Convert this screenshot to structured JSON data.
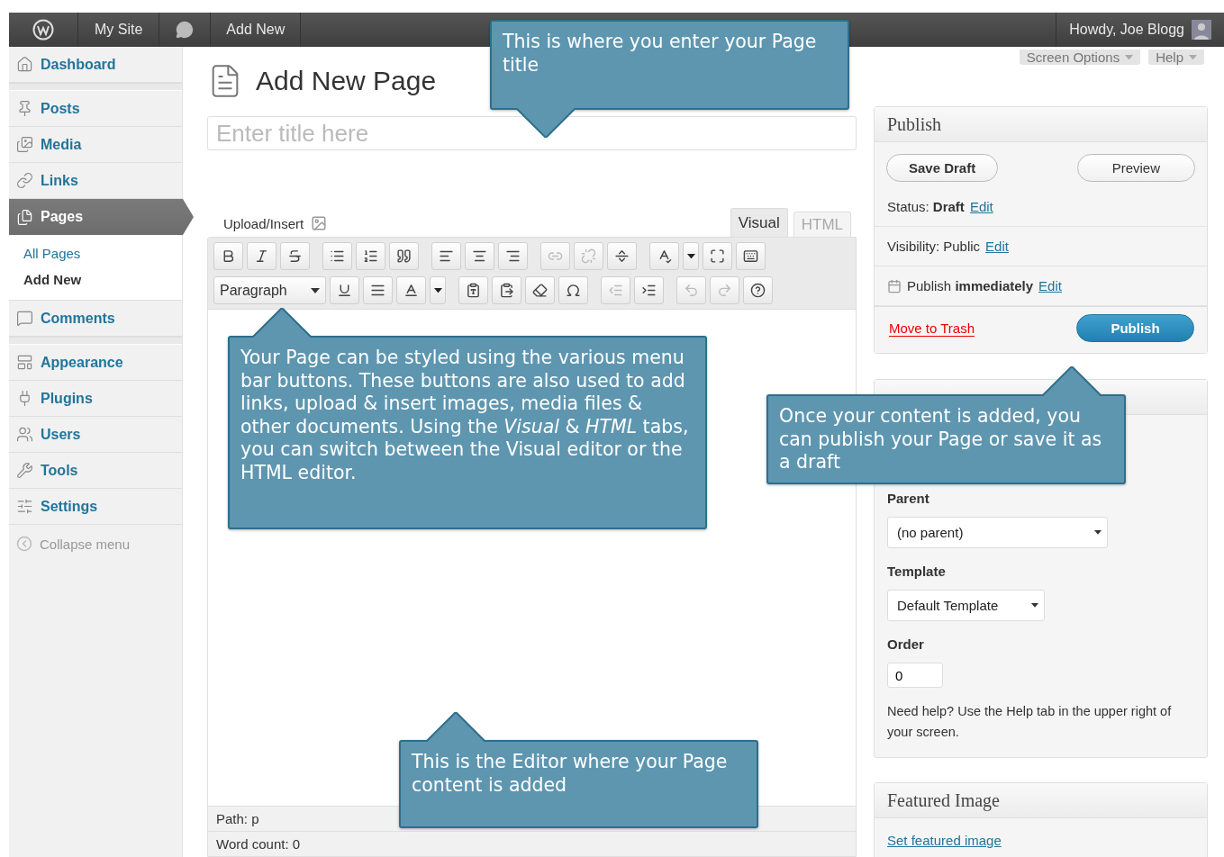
{
  "admin_bar": {
    "site": "My Site",
    "new": "Add New",
    "account": "Howdy, Joe Blogg"
  },
  "sidebar": {
    "groups": [
      [
        {
          "label": "Dashboard",
          "kind": "dashboard",
          "selected": false
        }
      ],
      [
        {
          "label": "Posts",
          "kind": "posts",
          "selected": false
        },
        {
          "label": "Media",
          "kind": "media",
          "selected": false
        },
        {
          "label": "Links",
          "kind": "links",
          "selected": false
        },
        {
          "label": "Pages",
          "kind": "pages",
          "selected": true,
          "children": [
            {
              "label": "All Pages",
              "selected": false
            },
            {
              "label": "Add New",
              "selected": true
            }
          ]
        },
        {
          "label": "Comments",
          "kind": "comments",
          "selected": false
        }
      ],
      [
        {
          "label": "Appearance",
          "kind": "appearance",
          "selected": false
        },
        {
          "label": "Plugins",
          "kind": "plugins",
          "selected": false
        },
        {
          "label": "Users",
          "kind": "users",
          "selected": false
        },
        {
          "label": "Tools",
          "kind": "tools",
          "selected": false
        },
        {
          "label": "Settings",
          "kind": "settings",
          "selected": false
        }
      ]
    ],
    "collapse": "Collapse menu"
  },
  "screen_meta": [
    "Screen Options",
    "Help"
  ],
  "page": {
    "title": "Add New Page",
    "title_placeholder": "Enter title here"
  },
  "editor": {
    "upload_label": "Upload/Insert",
    "tabs": [
      {
        "label": "Visual",
        "selected": true
      },
      {
        "label": "HTML",
        "selected": false
      }
    ],
    "toolbar_rows": [
      [
        {
          "kind": "bold",
          "disabled": false
        },
        {
          "kind": "italic",
          "disabled": false
        },
        {
          "kind": "strike",
          "disabled": false
        },
        {
          "kind": "gap"
        },
        {
          "kind": "bullets",
          "disabled": false
        },
        {
          "kind": "numbers",
          "disabled": false
        },
        {
          "kind": "quote",
          "disabled": false
        },
        {
          "kind": "gap"
        },
        {
          "kind": "align-left",
          "disabled": false
        },
        {
          "kind": "align-center",
          "disabled": false
        },
        {
          "kind": "align-right",
          "disabled": false
        },
        {
          "kind": "gap"
        },
        {
          "kind": "link",
          "disabled": true
        },
        {
          "kind": "unlink",
          "disabled": true
        },
        {
          "kind": "more",
          "disabled": false
        },
        {
          "kind": "gap"
        },
        {
          "kind": "spellcheck",
          "disabled": false
        },
        {
          "kind": "dropdown",
          "disabled": false
        },
        {
          "kind": "fullscreen",
          "disabled": false
        },
        {
          "kind": "kitchen-sink",
          "disabled": false
        }
      ],
      [
        {
          "kind": "format-select",
          "disabled": false
        },
        {
          "kind": "underline",
          "disabled": false
        },
        {
          "kind": "justify",
          "disabled": false
        },
        {
          "kind": "text-color",
          "disabled": false
        },
        {
          "kind": "dropdown",
          "disabled": false
        },
        {
          "kind": "gap"
        },
        {
          "kind": "paste-text",
          "disabled": false
        },
        {
          "kind": "paste-word",
          "disabled": false
        },
        {
          "kind": "eraser",
          "disabled": false
        },
        {
          "kind": "omega",
          "disabled": false
        },
        {
          "kind": "gap"
        },
        {
          "kind": "outdent",
          "disabled": true
        },
        {
          "kind": "indent",
          "disabled": false
        },
        {
          "kind": "gap"
        },
        {
          "kind": "undo",
          "disabled": true
        },
        {
          "kind": "redo",
          "disabled": true
        },
        {
          "kind": "help",
          "disabled": false
        }
      ]
    ],
    "format_select": "Paragraph",
    "path": "Path: p",
    "word_count": "Word count: 0"
  },
  "publish": {
    "title": "Publish",
    "save_draft": "Save Draft",
    "preview": "Preview",
    "rows": [
      {
        "kind": "plain",
        "text": "Status: **Draft**",
        "link": "Edit"
      },
      {
        "kind": "plain",
        "text": "Visibility: Public",
        "link": "Edit"
      },
      {
        "kind": "schedule",
        "text": "Publish **immediately**",
        "link": "Edit"
      }
    ],
    "trash": "Move to Trash",
    "publish": "Publish"
  },
  "page_attributes": {
    "parent_label": "Parent",
    "parent": "(no parent)",
    "template_label": "Template",
    "template": "Default Template",
    "order_label": "Order",
    "order": "0",
    "help": "Need help? Use the Help tab in the upper right of your screen."
  },
  "featured_image": {
    "title": "Featured Image",
    "link": "Set featured image"
  },
  "callouts": [
    {
      "text": "This is where you enter your Page title",
      "points_up": false
    },
    {
      "text": "Your Page can be styled using the various menu bar buttons. These buttons are also used to add links, upload & insert images, media files & other documents. Using the *Visual* & *HTML* tabs, you can switch between the Visual editor or the HTML editor.",
      "points_up": true
    },
    {
      "text": "Once your content is added, you can publish your Page or save it as a draft",
      "points_up": true
    },
    {
      "text": "This is the Editor where your Page content is added",
      "points_up": true
    }
  ]
}
